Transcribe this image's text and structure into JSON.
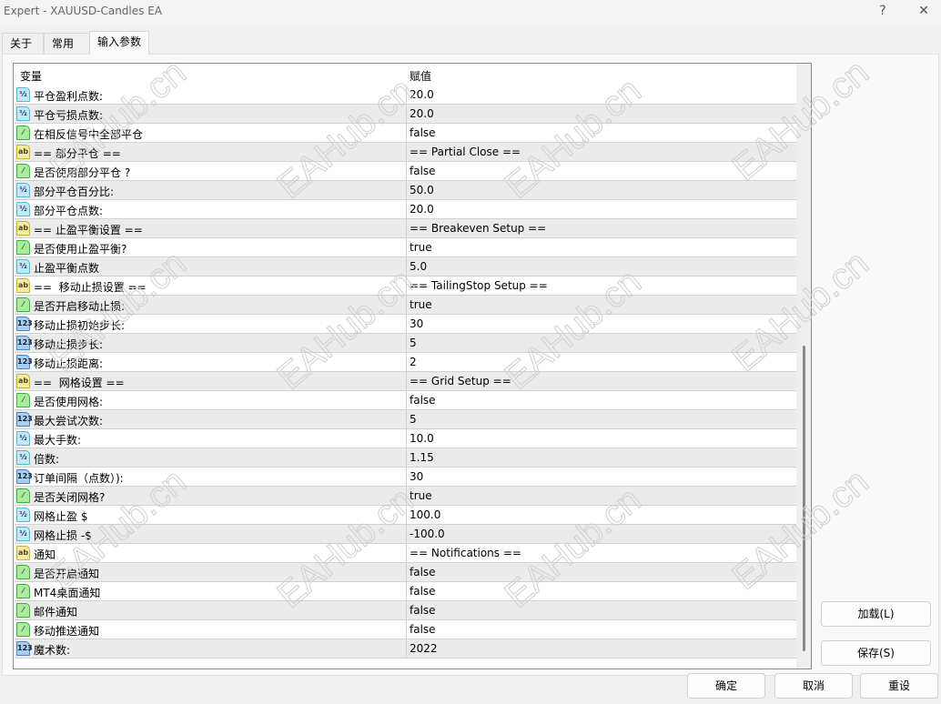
{
  "window": {
    "title": "Expert - XAUUSD-Candles EA",
    "help": "?",
    "close": "✕"
  },
  "tabs": [
    {
      "label": "关于"
    },
    {
      "label": "常用"
    },
    {
      "label": "输入参数"
    }
  ],
  "table": {
    "col_variable": "变量",
    "col_value": "赋值",
    "rows": [
      {
        "type": "d",
        "name": "平仓盈利点数:",
        "value": "20.0"
      },
      {
        "type": "d",
        "name": "平仓亏损点数:",
        "value": "20.0"
      },
      {
        "type": "b",
        "name": "在相反信号中全部平仓",
        "value": "false"
      },
      {
        "type": "s",
        "name": "== 部分平仓 ==",
        "value": "== Partial Close =="
      },
      {
        "type": "b",
        "name": "是否使用部分平仓 ?",
        "value": "false"
      },
      {
        "type": "d",
        "name": "部分平仓百分比:",
        "value": "50.0"
      },
      {
        "type": "d",
        "name": "部分平仓点数:",
        "value": "20.0"
      },
      {
        "type": "s",
        "name": "== 止盈平衡设置 ==",
        "value": "== Breakeven Setup =="
      },
      {
        "type": "b",
        "name": "是否使用止盈平衡?",
        "value": "true"
      },
      {
        "type": "d",
        "name": "止盈平衡点数",
        "value": "5.0"
      },
      {
        "type": "s",
        "name": "==  移动止损设置 ==",
        "value": "== TailingStop Setup =="
      },
      {
        "type": "b",
        "name": "是否开启移动止损:",
        "value": "true"
      },
      {
        "type": "i",
        "name": "移动止损初始步长:",
        "value": "30"
      },
      {
        "type": "i",
        "name": "移动止损步长:",
        "value": "5"
      },
      {
        "type": "i",
        "name": "移动止损距离:",
        "value": "2"
      },
      {
        "type": "s",
        "name": "==  网格设置 ==",
        "value": "== Grid Setup =="
      },
      {
        "type": "b",
        "name": "是否使用网格:",
        "value": "false"
      },
      {
        "type": "i",
        "name": "最大尝试次数:",
        "value": "5"
      },
      {
        "type": "d",
        "name": "最大手数:",
        "value": "10.0"
      },
      {
        "type": "d",
        "name": "倍数:",
        "value": "1.15"
      },
      {
        "type": "i",
        "name": "订单间隔（点数）):",
        "value": "30"
      },
      {
        "type": "b",
        "name": "是否关闭网格?",
        "value": "true"
      },
      {
        "type": "d",
        "name": "网格止盈 $",
        "value": "100.0"
      },
      {
        "type": "d",
        "name": "网格止损 -$",
        "value": "-100.0"
      },
      {
        "type": "s",
        "name": "通知",
        "value": "== Notifications =="
      },
      {
        "type": "b",
        "name": "是否开启通知",
        "value": "false"
      },
      {
        "type": "b",
        "name": "MT4桌面通知",
        "value": "false"
      },
      {
        "type": "b",
        "name": "邮件通知",
        "value": "false"
      },
      {
        "type": "b",
        "name": "移动推送通知",
        "value": "false"
      },
      {
        "type": "i",
        "name": "魔术数:",
        "value": "2022"
      }
    ]
  },
  "icons": {
    "d": "½",
    "b": "⁄",
    "s": "ab",
    "i": "123"
  },
  "buttons": {
    "load": "加载(L)",
    "save": "保存(S)",
    "ok": "确定",
    "cancel": "取消",
    "reset": "重设"
  },
  "watermark": "EAHub.cn"
}
